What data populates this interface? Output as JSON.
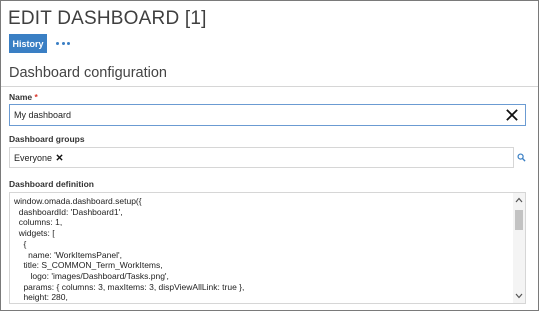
{
  "header": {
    "title": "EDIT DASHBOARD [1]"
  },
  "toolbar": {
    "history_label": "History"
  },
  "section": {
    "title": "Dashboard configuration"
  },
  "name_field": {
    "label": "Name",
    "required_marker": "*",
    "value": "My dashboard"
  },
  "groups_field": {
    "label": "Dashboard groups",
    "tags": [
      "Everyone"
    ]
  },
  "definition_field": {
    "label": "Dashboard definition",
    "lines": [
      "window.omada.dashboard.setup({",
      "  dashboardId: 'Dashboard1',",
      "  columns: 1,",
      "  widgets: [",
      "    {",
      "      name: 'WorkItemsPanel',",
      "    title: S_COMMON_Term_WorkItems,",
      "       logo: 'images/Dashboard/Tasks.png',",
      "    params: { columns: 3, maxItems: 3, dispViewAllLink: true },",
      "    height: 280,"
    ]
  },
  "icons": {
    "more": "more-dots-icon",
    "clear": "close-icon",
    "tag_remove": "close-icon",
    "search": "search-icon",
    "scroll_up": "chevron-up-icon",
    "scroll_down": "chevron-down-icon"
  },
  "colors": {
    "accent": "#3a7fc4",
    "required": "#d9352b"
  }
}
